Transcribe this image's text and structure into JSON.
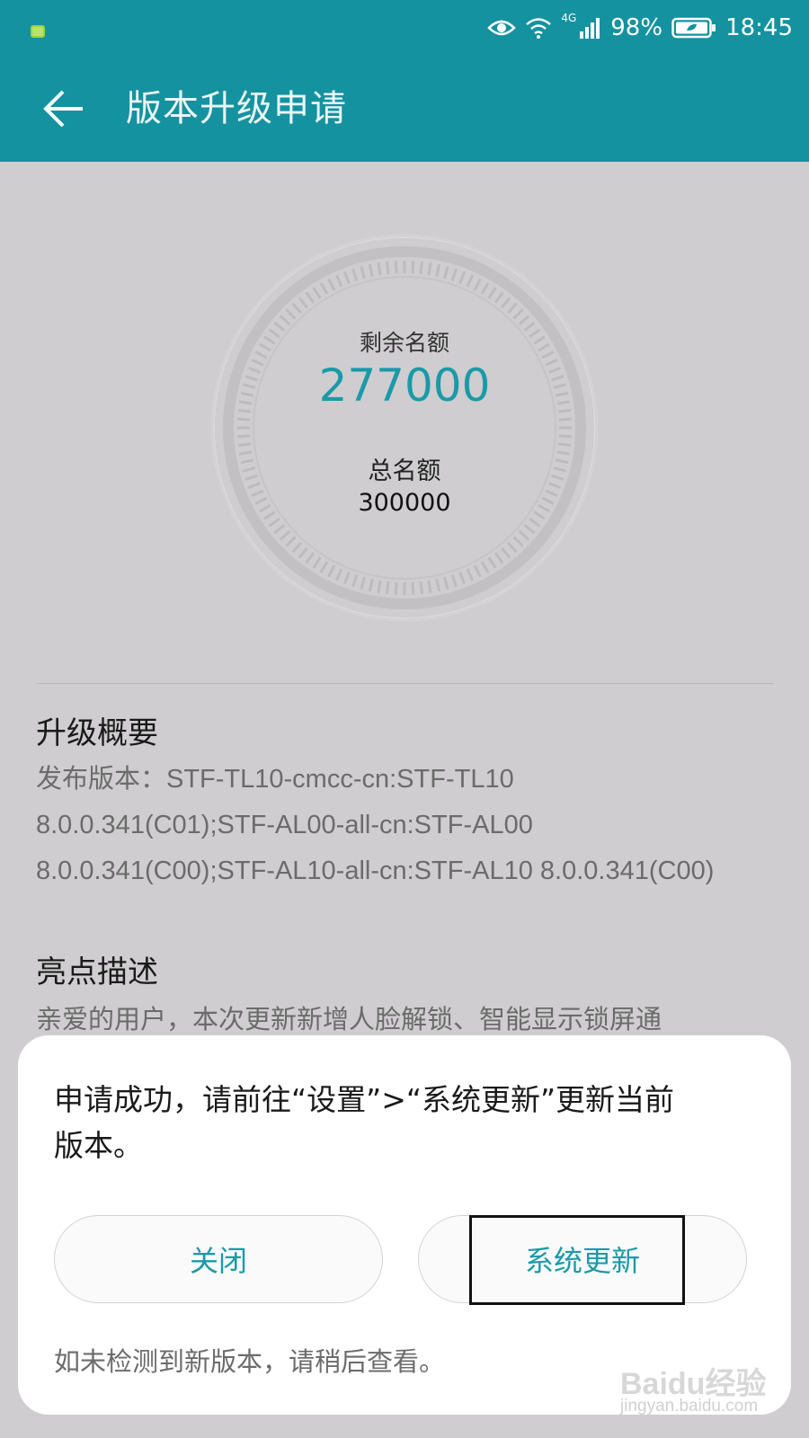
{
  "status_bar": {
    "network": "4G",
    "battery": "98%",
    "time": "18:45"
  },
  "toolbar": {
    "title": "版本升级申请"
  },
  "quota": {
    "remaining_label": "剩余名额",
    "remaining_value": "277000",
    "total_label": "总名额",
    "total_value": "300000"
  },
  "summary": {
    "title": "升级概要",
    "lines": [
      "发布版本：STF-TL10-cmcc-cn:STF-TL10",
      "8.0.0.341(C01);STF-AL00-all-cn:STF-AL00",
      "8.0.0.341(C00);STF-AL10-all-cn:STF-AL10 8.0.0.341(C00)"
    ]
  },
  "highlights": {
    "title": "亮点描述",
    "body": "亲爱的用户，本次更新新增人脸解锁、智能显示锁屏通"
  },
  "dialog": {
    "message_line1": "申请成功，请前往“设置”>“系统更新”更新当前",
    "message_line2": "版本。",
    "close_label": "关闭",
    "update_label": "系统更新",
    "note": "如未检测到新版本，请稍后查看。"
  },
  "watermark": {
    "logo": "Baidu经验",
    "sub": "jingyan.baidu.com"
  },
  "colors": {
    "accent": "#1592a0",
    "link": "#1a9aa8"
  }
}
